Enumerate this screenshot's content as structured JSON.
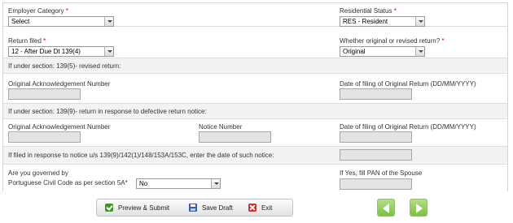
{
  "employer_category": {
    "label": "Employer Category",
    "required": "*",
    "value": "Select"
  },
  "residential_status": {
    "label": "Residential Status",
    "required": "*",
    "value": "RES - Resident"
  },
  "return_filed": {
    "label": "Return filed",
    "required": "*",
    "value": "12 - After Due Dt 139(4)"
  },
  "original_or_revised": {
    "label": "Whether original or revised return?",
    "required": "*",
    "value": "Original"
  },
  "section_139_5": {
    "heading": "If under section: 139(5)- revised return:",
    "ack_label": "Original Acknowledgement Number",
    "date_label": "Date of filing of Original Return (DD/MM/YYYY)"
  },
  "section_139_9": {
    "heading": "If under section: 139(9)- return in response to defective return notice:",
    "ack_label": "Original Acknowledgement Number",
    "notice_label": "Notice Number",
    "date_label": "Date of filing of Original Return (DD/MM/YYYY)"
  },
  "notice_date": {
    "label": "If filed in response to notice u/s 139(9)/142(1)/148/153A/153C, enter the date of such notice:"
  },
  "portuguese_code": {
    "label_line1": "Are you governed by",
    "label_line2": "Portuguese Civil Code as per section 5A",
    "required": "*",
    "value": "No"
  },
  "spouse_pan": {
    "label": "If Yes, fill PAN of the Spouse"
  },
  "toolbar": {
    "preview_submit": "Preview & Submit",
    "save_draft": "Save Draft",
    "exit": "Exit"
  },
  "colors": {
    "required": "#cc0000",
    "nav_green": "#7fbf44",
    "border": "#c9d6e3"
  },
  "icons": [
    "check-icon",
    "save-icon",
    "exit-icon",
    "arrow-left-icon",
    "arrow-right-icon",
    "chevron-down-icon"
  ]
}
